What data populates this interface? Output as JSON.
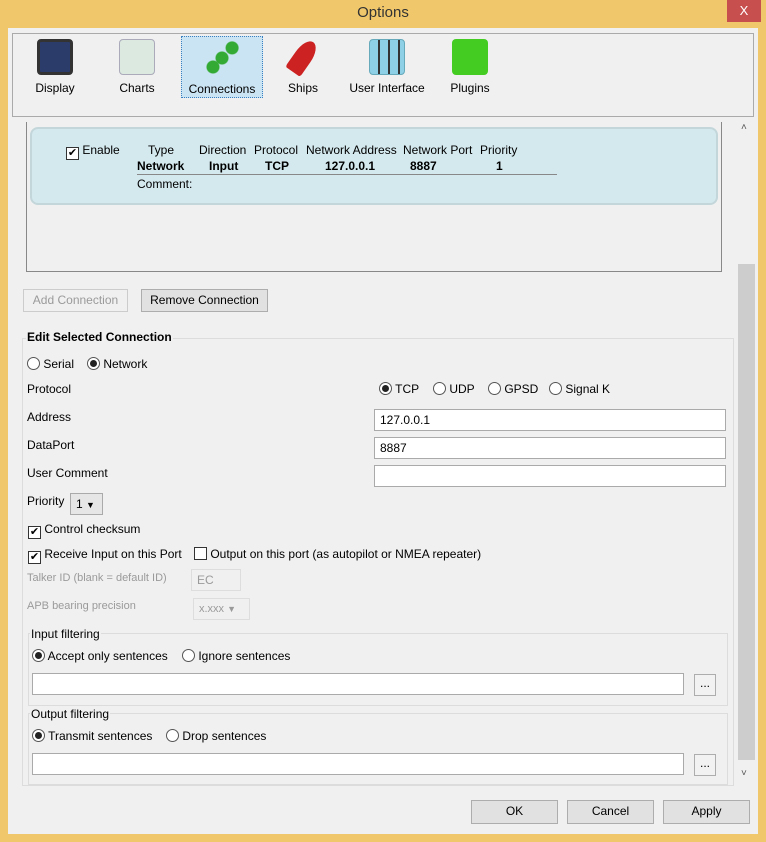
{
  "window": {
    "title": "Options",
    "close": "X"
  },
  "toolbar": {
    "items": [
      {
        "label": "Display",
        "icon": "display-icon"
      },
      {
        "label": "Charts",
        "icon": "charts-icon"
      },
      {
        "label": "Connections",
        "icon": "connections-icon",
        "selected": true
      },
      {
        "label": "Ships",
        "icon": "ships-icon"
      },
      {
        "label": "User Interface",
        "icon": "user-interface-icon"
      },
      {
        "label": "Plugins",
        "icon": "plugins-icon"
      }
    ]
  },
  "connection_list": {
    "enable_label": "Enable",
    "enabled": true,
    "headers": [
      "Type",
      "Direction",
      "Protocol",
      "Network Address",
      "Network Port",
      "Priority"
    ],
    "values": [
      "Network",
      "Input",
      "TCP",
      "127.0.0.1",
      "8887",
      "1"
    ],
    "comment_label": "Comment:"
  },
  "buttons": {
    "add": "Add Connection",
    "remove": "Remove Connection",
    "ok": "OK",
    "cancel": "Cancel",
    "apply": "Apply",
    "browse": "..."
  },
  "edit": {
    "title": "Edit Selected Connection",
    "serial": "Serial",
    "network": "Network",
    "protocol_label": "Protocol",
    "protocols": [
      "TCP",
      "UDP",
      "GPSD",
      "Signal K"
    ],
    "protocol_selected": "TCP",
    "address_label": "Address",
    "address": "127.0.0.1",
    "dataport_label": "DataPort",
    "dataport": "8887",
    "comment_label": "User Comment",
    "comment": "",
    "priority_label": "Priority",
    "priority": "1",
    "checksum": "Control checksum",
    "receive": "Receive Input on this Port",
    "output": "Output on this port (as autopilot or NMEA repeater)",
    "talker_label": "Talker ID (blank = default ID)",
    "talker": "EC",
    "apb_label": "APB bearing precision",
    "apb": "x.xxx",
    "input_filtering": "Input filtering",
    "accept": "Accept only sentences",
    "ignore": "Ignore sentences",
    "output_filtering": "Output filtering",
    "transmit": "Transmit sentences",
    "drop": "Drop sentences"
  }
}
